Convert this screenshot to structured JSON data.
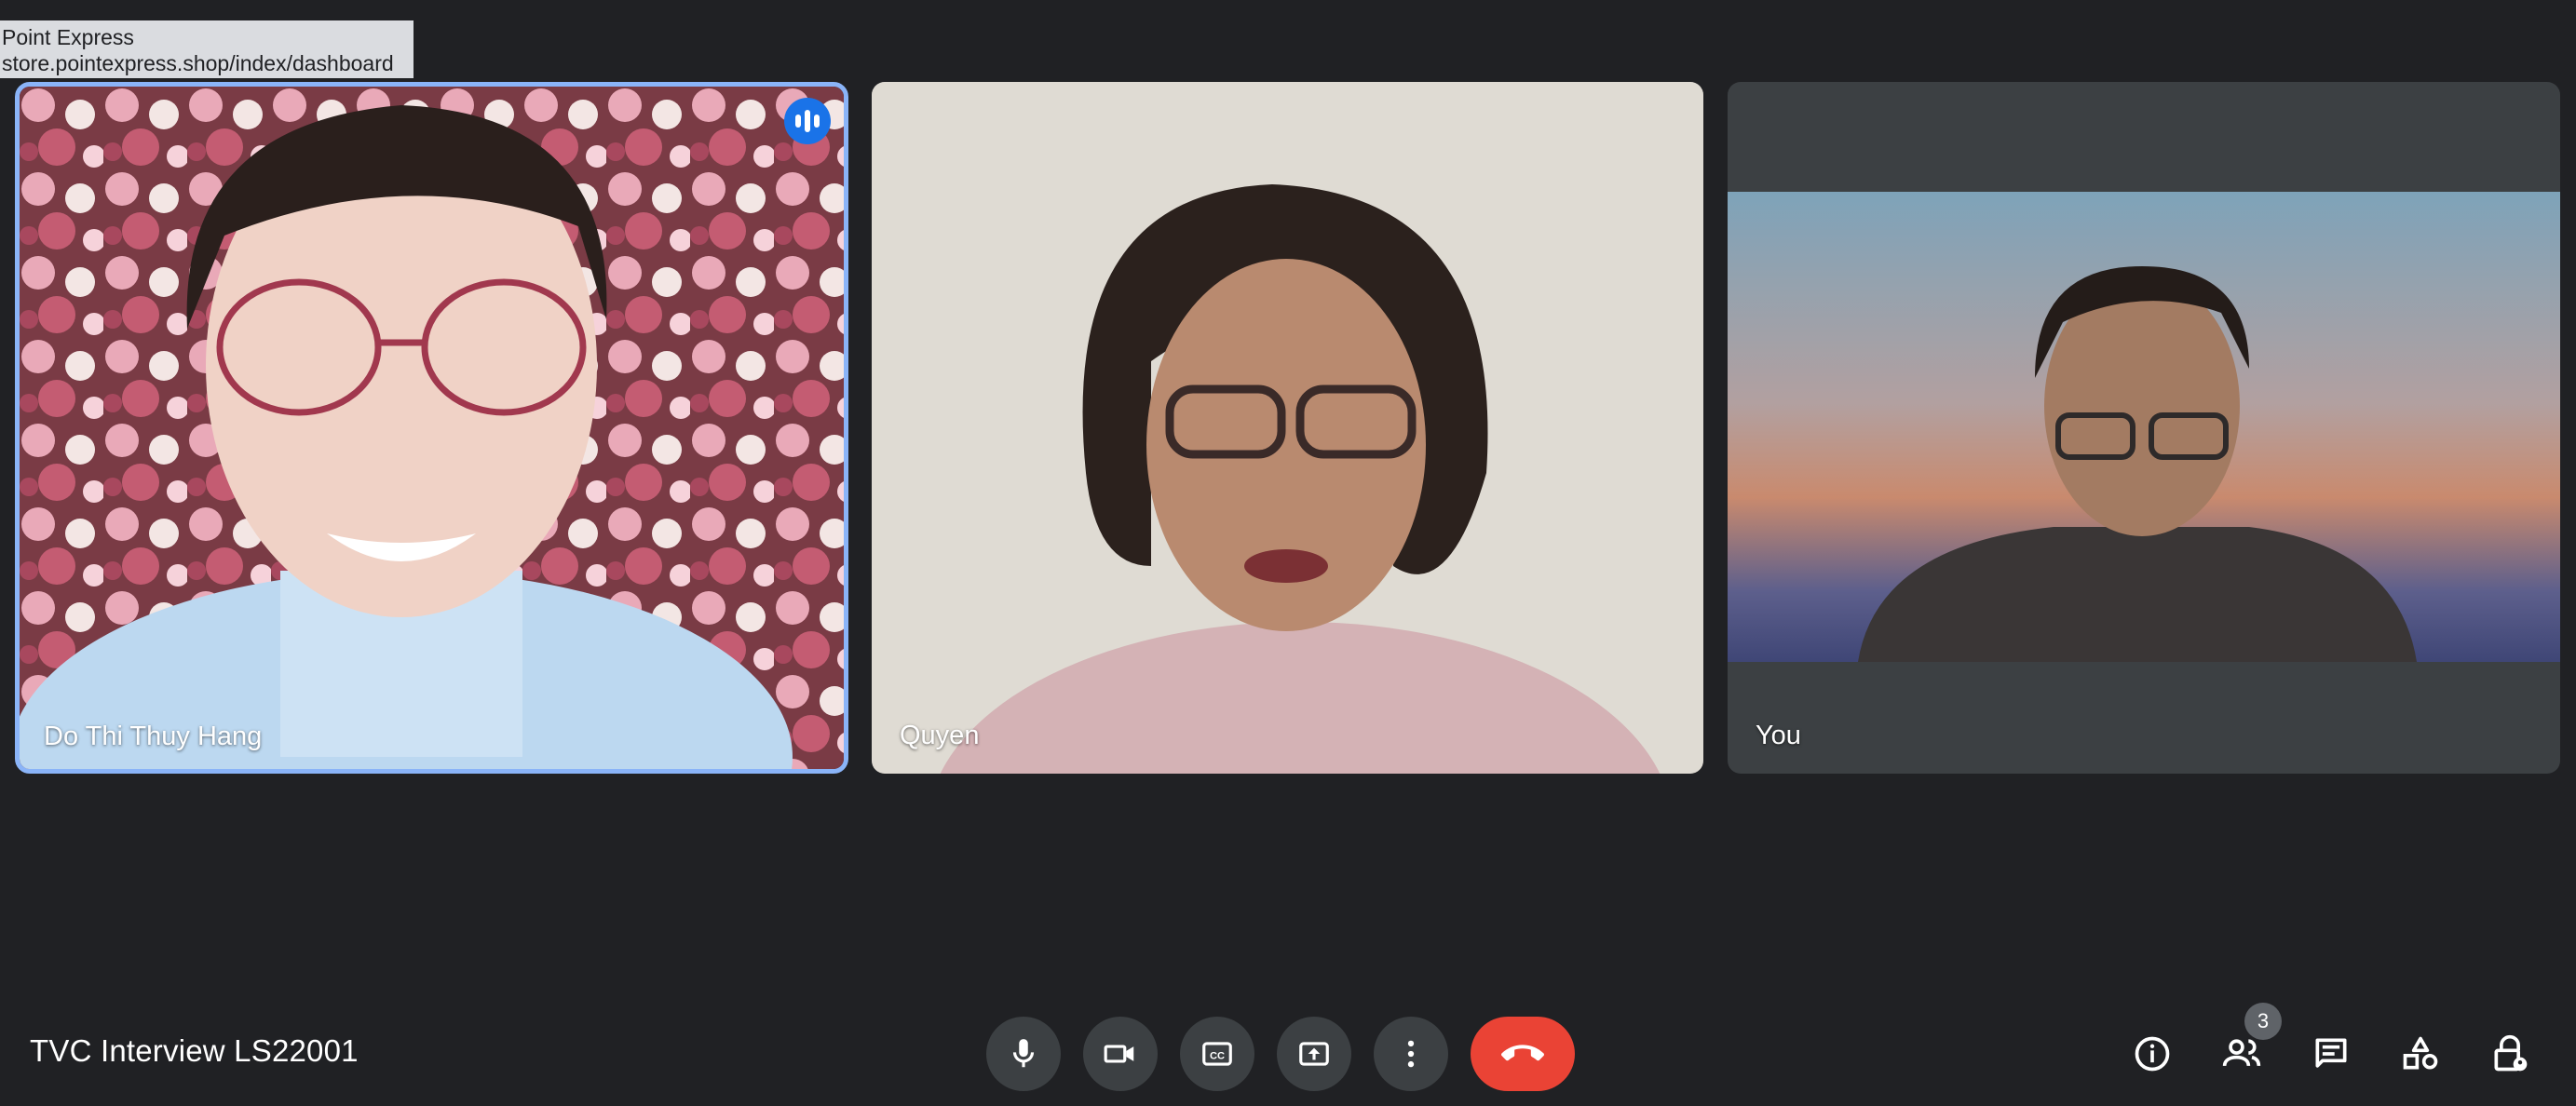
{
  "hover_url": {
    "title": "Point Express",
    "url": "store.pointexpress.shop/index/dashboard"
  },
  "participants": [
    {
      "name": "Do Thi Thuy Hang",
      "speaking": true
    },
    {
      "name": "Quyen",
      "speaking": false
    },
    {
      "name": "You",
      "speaking": false
    }
  ],
  "meeting": {
    "title": "TVC Interview LS22001"
  },
  "controls": [
    {
      "icon": "microphone-icon"
    },
    {
      "icon": "camera-icon"
    },
    {
      "icon": "captions-icon"
    },
    {
      "icon": "present-screen-icon"
    },
    {
      "icon": "more-options-icon"
    },
    {
      "icon": "end-call-icon"
    }
  ],
  "side_controls": {
    "people_count": "3",
    "icons": [
      "info-icon",
      "people-icon",
      "chat-icon",
      "activities-icon",
      "host-controls-icon"
    ]
  },
  "colors": {
    "background": "#202124",
    "tile_gray": "#3c4043",
    "active_speaker_border": "#8ab4f8",
    "end_call": "#ea4335",
    "speaking_badge": "#1a73e8"
  }
}
